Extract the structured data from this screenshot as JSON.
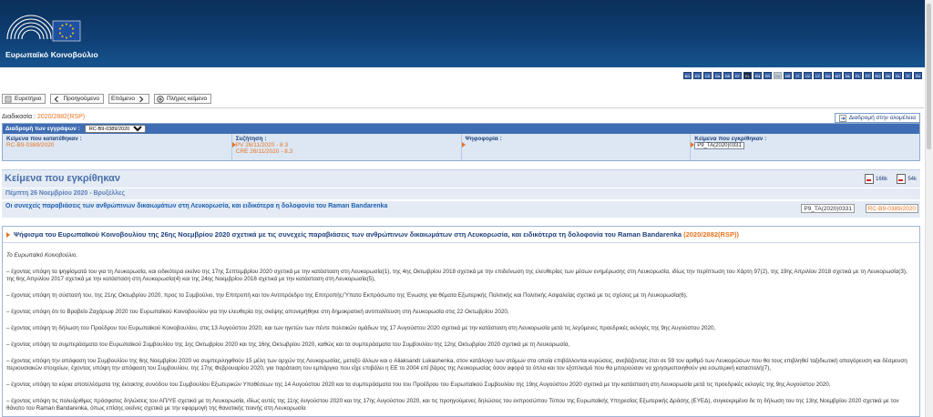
{
  "header": {
    "logo_text": "Ευρωπαϊκό Κοινοβούλιο",
    "languages": [
      "BG",
      "ES",
      "CS",
      "DA",
      "DE",
      "ET",
      "EL",
      "EN",
      "FR",
      "GA",
      "HR",
      "IT",
      "LV",
      "LT",
      "HU",
      "MT",
      "NL",
      "PL",
      "PT",
      "RO",
      "SK",
      "SL",
      "FI",
      "SV"
    ],
    "selected_language": "EL"
  },
  "nav": {
    "index": "Ευρετήριο",
    "previous": "Προηγούμενο",
    "next": "Επόμενο",
    "full_text": "Πλήρες κείμενο"
  },
  "procedure": {
    "label": "Διαδικασία :",
    "code": "2020/2882(RSP)",
    "full_route": "Διαδρομή στην ολομέλεια",
    "route_label": "Διαδρομή των εγγράφων :",
    "route_select": "RC-B9-0389/2020",
    "columns": [
      {
        "label": "Κείμενα που κατατέθηκαν :",
        "values": [
          "RC-B9-0389/2020"
        ]
      },
      {
        "label": "Συζήτηση :",
        "values": [
          "PV 26/11/2020 - 8.3",
          "CRE 26/11/2020 - 8.3"
        ]
      },
      {
        "label": "Ψηφοφορία :",
        "values": []
      },
      {
        "label": "Κείμενα που εγκρίθηκαν :",
        "values": [
          "P9_TA(2020)0331"
        ]
      }
    ]
  },
  "main": {
    "title": "Κείμενα που εγκρίθηκαν",
    "pdf_size": "166k",
    "doc_size": "54k",
    "date": "Πέμπτη 26 Νοεμβρίου 2020 - Βρυξέλλες",
    "subject": "Οι συνεχείς παραβιάσεις των ανθρώπινων δικαιωμάτων στη Λευκορωσία, και ειδικότερα η δολοφονία του Raman Bandarenka",
    "ref_ta": "P9_TA(2020)0331",
    "ref_rc": "RC-B9-0389/2020"
  },
  "resolution": {
    "title": "Ψήφισμα του Ευρωπαϊκού Κοινοβουλίου της 26ης Νοεμβρίου 2020 σχετικά με τις συνεχείς παραβιάσεις των ανθρώπινων δικαιωμάτων στη Λευκορωσία, και ειδικότερα τη δολοφονία του Raman Bandarenka",
    "code": "(2020/2882(RSP))",
    "intro": "Το Ευρωπαϊκό Κοινοβούλιο,",
    "paragraphs": [
      "– έχοντας υπόψη τα ψηφίσματά του για τη Λευκορωσία, και ειδικότερα εκείνο της 17ης Σεπτεμβρίου 2020 σχετικά με την κατάσταση στη Λευκορωσία(1), της 4ης Οκτωβρίου 2018 σχετικά με την επιδείνωση της ελευθερίας των μέσων ενημέρωσης στη Λευκορωσία, ιδίως την περίπτωση του Χάρτη 97(2), της 19ης Απριλίου 2018 σχετικά με τη Λευκορωσία(3), της 6ης Απριλίου 2017 σχετικά με την κατάσταση στη Λευκορωσία(4) και της 24ης Νοεμβρίου 2016 σχετικά με την κατάσταση στη Λευκορωσία(5),",
      "– έχοντας υπόψη τη σύστασή του, της 21ης Οκτωβρίου 2020, προς το Συμβούλιο, την Επιτροπή και τον Αντιπρόεδρο της Επιτροπής/Ύπατο Εκπρόσωπο της Ένωσης για θέματα Εξωτερικής Πολιτικής και Πολιτικής Ασφαλείας σχετικά με τις σχέσεις με τη Λευκορωσία(6),",
      "– έχοντας υπόψη ότι το Βραβείο Ζαχάρωφ 2020 του Ευρωπαϊκού Κοινοβουλίου για την ελευθερία της σκέψης απονεμήθηκε στη δημοκρατική αντιπολίτευση στη Λευκορωσία στις 22 Οκτωβρίου 2020,",
      "– έχοντας υπόψη τη δήλωση του Προέδρου του Ευρωπαϊκού Κοινοβουλίου, στις 13 Αυγούστου 2020, και των ηγετών των πέντε πολιτικών ομάδων της 17 Αυγούστου 2020 σχετικά με την κατάσταση στη Λευκορωσία μετά τις λεγόμενες προεδρικές εκλογές της 9ης Αυγούστου 2020,",
      "– έχοντας υπόψη τα συμπεράσματα του Ευρωπαϊκού Συμβουλίου της 1ης Οκτωβρίου 2020 και της 16ης Οκτωβρίου 2020, καθώς και τα συμπεράσματα του Συμβουλίου της 12ης Οκτωβρίου 2020 σχετικά με τη Λευκορωσία,",
      "– έχοντας υπόψη την απόφαση του Συμβουλίου της 6ης Νοεμβρίου 2020 να συμπεριληφθούν 15 μέλη των αρχών της Λευκορωσίας, μεταξύ άλλων και ο Aliaksandr Lukashenka, στον κατάλογο των ατόμων στα οποία επιβάλλονται κυρώσεις, ανεβάζοντας έτσι σε 59 τον αριθμό των Λευκορώσων που θα τους επιβληθεί ταξιδιωτική απαγόρευση και δέσμευση περιουσιακών στοιχείων, έχοντας υπόψη την απόφαση του Συμβουλίου, της 17ης Φεβρουαρίου 2020, για παράταση του εμπάργκο που είχε επιβάλει η ΕΕ το 2004 επί βάρος της Λευκορωσίας όσον αφορά τα όπλα και τον εξοπλισμό που θα μπορούσαν να χρησιμοποιηθούν για εσωτερική καταστολή(7),",
      "– έχοντας υπόψη τα κύρια αποτελέσματα της έκτακτης συνόδου του Συμβουλίου Εξωτερικών Υποθέσεων της 14 Αυγούστου 2020 και τα συμπεράσματα του του Προέδρου του Ευρωπαϊκού Συμβουλίου της 19ης Αυγούστου 2020 σχετικά με την κατάσταση στη Λευκορωσία μετά τις προεδρικές εκλογές της 9ης Αυγούστου 2020,",
      "– έχοντας υπόψη τις πολυάριθμες πρόσφατες δηλώσεις του ΑΠ/ΥΕ σχετικά με τη Λευκορωσία, ιδίως αυτές της 11ης Αυγούστου 2020 και της 17ης Αυγούστου 2020, και τις προηγούμενες δηλώσεις του εκπροσώπου Τύπου της Ευρωπαϊκής Υπηρεσίας Εξωτερικής Δράσης (ΕΥΕΔ), συγκεκριμένα δε τη δήλωση του της 13ης Νοεμβρίου 2020 σχετικά με τον θάνατο του Raman Bandarenka, όπως επίσης εκείνες σχετικά με την εφαρμογή της θανατικής ποινής στη Λευκορωσία"
    ]
  }
}
